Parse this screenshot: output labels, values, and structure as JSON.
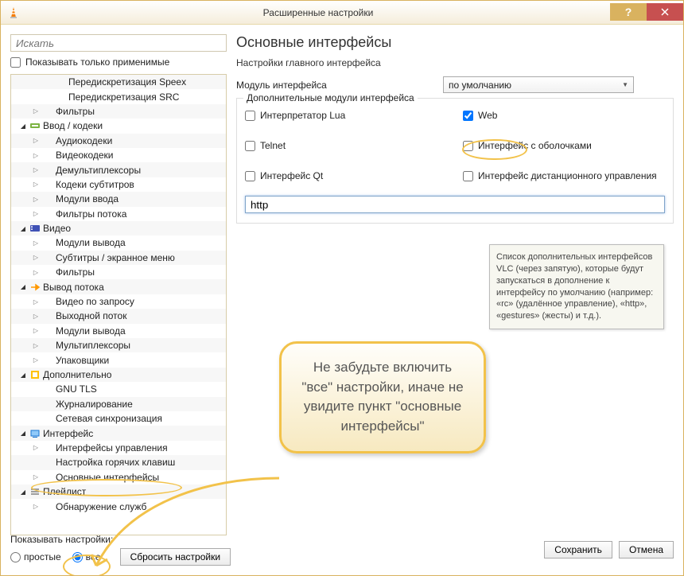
{
  "window": {
    "title": "Расширенные настройки"
  },
  "search": {
    "placeholder": "Искать"
  },
  "show_only_applicable": "Показывать только применимые",
  "tree": {
    "items": [
      {
        "level": 2,
        "tw": "",
        "icon": "",
        "label": "Передискретизация Speex"
      },
      {
        "level": 2,
        "tw": "",
        "icon": "",
        "label": "Передискретизация SRC"
      },
      {
        "level": 1,
        "tw": "closed",
        "icon": "",
        "label": "Фильтры"
      },
      {
        "level": 0,
        "tw": "open",
        "icon": "io",
        "label": "Ввод / кодеки"
      },
      {
        "level": 1,
        "tw": "closed",
        "icon": "",
        "label": "Аудиокодеки"
      },
      {
        "level": 1,
        "tw": "closed",
        "icon": "",
        "label": "Видеокодеки"
      },
      {
        "level": 1,
        "tw": "closed",
        "icon": "",
        "label": "Демультиплексоры"
      },
      {
        "level": 1,
        "tw": "closed",
        "icon": "",
        "label": "Кодеки субтитров"
      },
      {
        "level": 1,
        "tw": "closed",
        "icon": "",
        "label": "Модули ввода"
      },
      {
        "level": 1,
        "tw": "closed",
        "icon": "",
        "label": "Фильтры потока"
      },
      {
        "level": 0,
        "tw": "open",
        "icon": "video",
        "label": "Видео"
      },
      {
        "level": 1,
        "tw": "closed",
        "icon": "",
        "label": "Модули вывода"
      },
      {
        "level": 1,
        "tw": "closed",
        "icon": "",
        "label": "Субтитры / экранное меню"
      },
      {
        "level": 1,
        "tw": "closed",
        "icon": "",
        "label": "Фильтры"
      },
      {
        "level": 0,
        "tw": "open",
        "icon": "stream",
        "label": "Вывод потока"
      },
      {
        "level": 1,
        "tw": "closed",
        "icon": "",
        "label": "Видео по запросу"
      },
      {
        "level": 1,
        "tw": "closed",
        "icon": "",
        "label": "Выходной поток"
      },
      {
        "level": 1,
        "tw": "closed",
        "icon": "",
        "label": "Модули вывода"
      },
      {
        "level": 1,
        "tw": "closed",
        "icon": "",
        "label": "Мультиплексоры"
      },
      {
        "level": 1,
        "tw": "closed",
        "icon": "",
        "label": "Упаковщики"
      },
      {
        "level": 0,
        "tw": "open",
        "icon": "adv",
        "label": "Дополнительно"
      },
      {
        "level": 1,
        "tw": "",
        "icon": "",
        "label": "GNU TLS"
      },
      {
        "level": 1,
        "tw": "",
        "icon": "",
        "label": "Журналирование"
      },
      {
        "level": 1,
        "tw": "",
        "icon": "",
        "label": "Сетевая синхронизация"
      },
      {
        "level": 0,
        "tw": "open",
        "icon": "iface",
        "label": "Интерфейс"
      },
      {
        "level": 1,
        "tw": "closed",
        "icon": "",
        "label": "Интерфейсы управления"
      },
      {
        "level": 1,
        "tw": "",
        "icon": "",
        "label": "Настройка горячих клавиш"
      },
      {
        "level": 1,
        "tw": "closed",
        "icon": "",
        "label": "Основные интерфейсы"
      },
      {
        "level": 0,
        "tw": "open",
        "icon": "playlist",
        "label": "Плейлист"
      },
      {
        "level": 1,
        "tw": "closed",
        "icon": "",
        "label": "Обнаружение служб"
      }
    ]
  },
  "main": {
    "heading": "Основные интерфейсы",
    "subheading": "Настройки главного интерфейса",
    "module_label": "Модуль интерфейса",
    "module_value": "по умолчанию",
    "fieldset_legend": "Дополнительные модули интерфейса",
    "checkboxes": {
      "lua": "Интерпретатор Lua",
      "web": "Web",
      "telnet": "Telnet",
      "skins": "Интерфейс с оболочками",
      "qt": "Интерфейс Qt",
      "remote": "Интерфейс дистанционного управления"
    },
    "input_value": "http",
    "tooltip": "Список дополнительных интерфейсов VLC (через запятую), которые будут запускаться в дополнение к интерфейсу по умолчанию (например: «rc» (удалённое управление), «http», «gestures» (жесты) и т.д.)."
  },
  "callout": "Не забудьте включить \"все\" настройки, иначе не увидите пункт \"основные интерфейсы\"",
  "footer": {
    "show_settings": "Показывать настройки:",
    "simple": "простые",
    "all": "все",
    "reset": "Сбросить настройки",
    "save": "Сохранить",
    "cancel": "Отмена"
  }
}
